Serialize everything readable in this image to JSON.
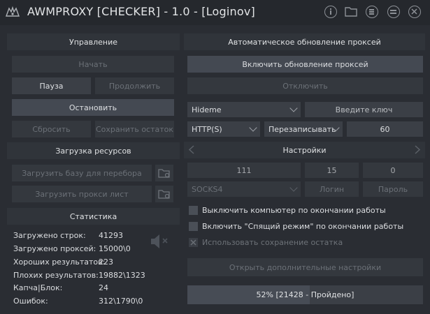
{
  "app": {
    "title": "AWMPROXY [CHECKER] - 1.0 - [Loginov]",
    "accent": "#3b3f46",
    "background": "#2a2d33"
  },
  "titlebar_icons": [
    "info-icon",
    "folder-icon",
    "list-icon",
    "menu-icon",
    "close-icon"
  ],
  "control": {
    "title": "Управление",
    "start": "Начать",
    "pause": "Пауза",
    "resume": "Продолжить",
    "stop": "Остановить",
    "reset": "Сбросить",
    "save_rest": "Сохранить остаток"
  },
  "resources": {
    "title": "Загрузка ресурсов",
    "load_base": "Загрузить базу для перебора",
    "load_proxy": "Загрузить прокси лист"
  },
  "stats": {
    "title": "Статистика",
    "rows": [
      {
        "label": "Загружено строк:",
        "value": "41293"
      },
      {
        "label": "Загружено проксей:",
        "value": "15000\\0"
      },
      {
        "label": "Хороших результатов:",
        "value": "223"
      },
      {
        "label": "Плохих результатов:",
        "value": "19882\\1323"
      },
      {
        "label": "Капча|Блок:",
        "value": "24"
      },
      {
        "label": "Ошибок:",
        "value": "312\\1790\\0"
      }
    ]
  },
  "auto_update": {
    "title": "Автоматическое обновление проксей",
    "enable": "Включить обновление проксей",
    "disable": "Отключить",
    "source": "Hideme",
    "key_placeholder": "Введите ключ",
    "proxy_type": "HTTP(S)",
    "mode": "Перезаписывать",
    "interval": "60"
  },
  "settings": {
    "title": "Настройки",
    "threads": "111",
    "timeout": "15",
    "retries": "0",
    "proxy_protocol": "SOCKS4",
    "login_placeholder": "Логин",
    "password_placeholder": "Пароль",
    "options": [
      {
        "label": "Выключить компьютер по окончании работы",
        "checked": false,
        "enabled": true
      },
      {
        "label": "Включить \"Спящий режим\" по окончании работы",
        "checked": false,
        "enabled": true
      },
      {
        "label": "Использовать сохранение остатка",
        "checked": true,
        "enabled": false
      }
    ],
    "advanced": "Открыть дополнительные настройки"
  },
  "progress": {
    "percent": 52,
    "text": "52% [21428 - Пройдено]"
  }
}
